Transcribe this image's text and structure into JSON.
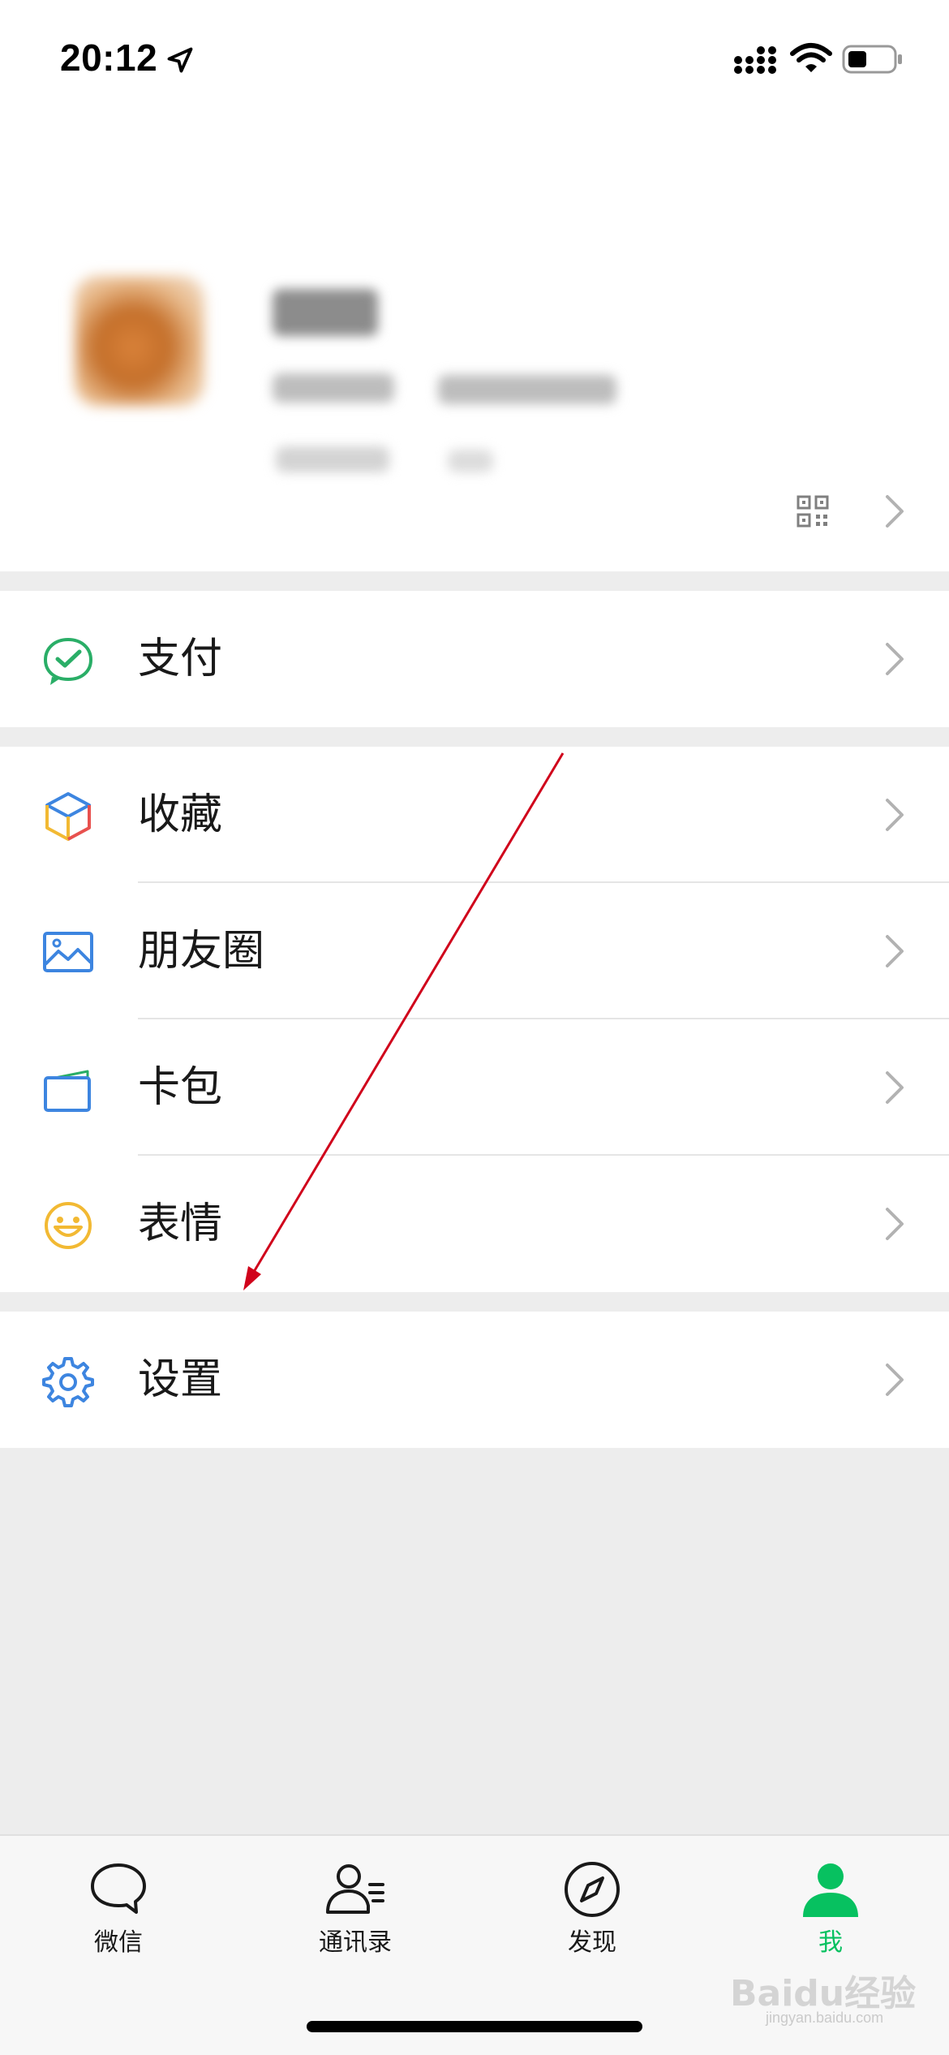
{
  "status_bar": {
    "time": "20:12"
  },
  "profile": {
    "has_qr": true
  },
  "menu": {
    "pay": {
      "label": "支付"
    },
    "favorites": {
      "label": "收藏"
    },
    "moments": {
      "label": "朋友圈"
    },
    "cards": {
      "label": "卡包"
    },
    "stickers": {
      "label": "表情"
    },
    "settings": {
      "label": "设置"
    }
  },
  "tabbar": {
    "chats": "微信",
    "contacts": "通讯录",
    "discover": "发现",
    "me": "我",
    "active": "me"
  },
  "colors": {
    "accent_green": "#07c160",
    "annotation_red": "#d0021b",
    "background": "#ededed"
  },
  "watermark": {
    "brand": "Baidu经验",
    "url": "jingyan.baidu.com"
  }
}
